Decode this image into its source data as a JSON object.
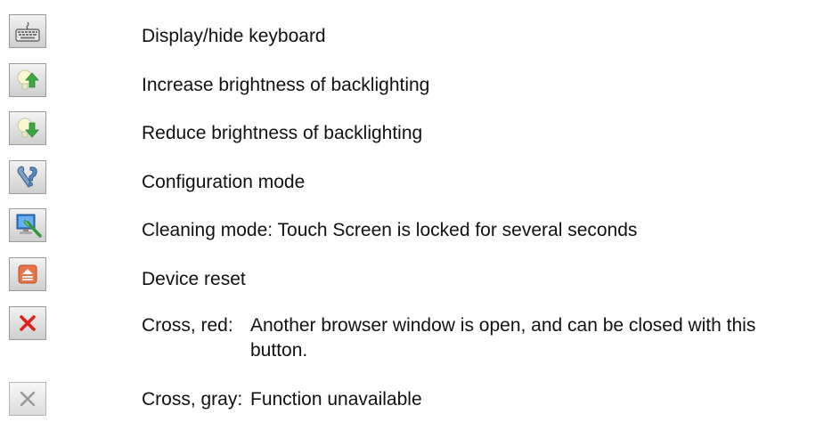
{
  "items": [
    {
      "icon": "keyboard-icon",
      "text": "Display/hide keyboard"
    },
    {
      "icon": "brightness-up-icon",
      "text": "Increase brightness of backlighting"
    },
    {
      "icon": "brightness-down-icon",
      "text": "Reduce brightness of backlighting"
    },
    {
      "icon": "configuration-icon",
      "text": "Configuration mode"
    },
    {
      "icon": "cleaning-icon",
      "text": "Cleaning mode: Touch Screen is locked for several seconds"
    },
    {
      "icon": "device-reset-icon",
      "text": "Device reset"
    },
    {
      "icon": "close-red-icon",
      "term": "Cross, red:",
      "text": "Another browser window is open, and can be closed with this button."
    },
    {
      "icon": "close-gray-icon",
      "term": "Cross, gray:",
      "text": "Function unavailable"
    }
  ],
  "colors": {
    "arrow_green": "#3aa845",
    "cross_red": "#e0201a",
    "cross_gray": "#9a9a9a",
    "reset_orange": "#e8734a"
  }
}
